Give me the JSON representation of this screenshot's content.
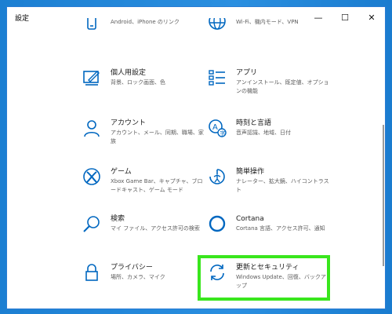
{
  "window": {
    "title": "設定",
    "minimize_glyph": "—",
    "maximize_glyph": "☐",
    "close_glyph": "✕"
  },
  "tiles": [
    {
      "icon": "phone-icon",
      "name": "",
      "desc": "Android、iPhone のリンク"
    },
    {
      "icon": "globe-icon",
      "name": "",
      "desc": "Wi-Fi、機内モード、VPN"
    },
    {
      "icon": "personalization-icon",
      "name": "個人用設定",
      "desc": "背景、ロック画面、色"
    },
    {
      "icon": "apps-icon",
      "name": "アプリ",
      "desc": "アンインストール、既定値、オプションの機能"
    },
    {
      "icon": "person-icon",
      "name": "アカウント",
      "desc": "アカウント、メール、同期、職場、家族"
    },
    {
      "icon": "time-language-icon",
      "name": "時刻と言語",
      "desc": "音声認識、地域、日付"
    },
    {
      "icon": "xbox-icon",
      "name": "ゲーム",
      "desc": "Xbox Game Bar、キャプチャ、ブロードキャスト、ゲーム モード"
    },
    {
      "icon": "ease-of-access-icon",
      "name": "簡単操作",
      "desc": "ナレーター、拡大鏡、ハイコントラスト"
    },
    {
      "icon": "search-icon",
      "name": "検索",
      "desc": "マイ ファイル、アクセス許可の検索"
    },
    {
      "icon": "cortana-icon",
      "name": "Cortana",
      "desc": "Cortana 言語、アクセス許可、通知"
    },
    {
      "icon": "lock-icon",
      "name": "プライバシー",
      "desc": "場所、カメラ、マイク"
    },
    {
      "icon": "sync-icon",
      "name": "更新とセキュリティ",
      "desc": "Windows Update、回復、バックアップ"
    }
  ],
  "colors": {
    "accent": "#0067c0",
    "highlight": "#39e61d"
  }
}
